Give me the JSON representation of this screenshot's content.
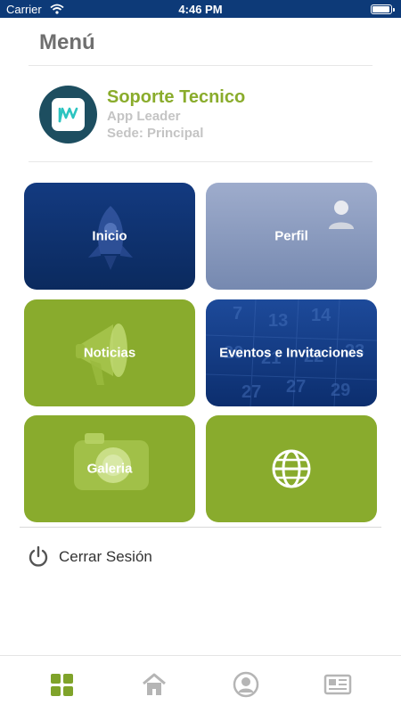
{
  "status_bar": {
    "carrier": "Carrier",
    "time": "4:46 PM"
  },
  "menu": {
    "title": "Menú"
  },
  "profile": {
    "name": "Soporte Tecnico",
    "role": "App Leader",
    "site": "Sede: Principal"
  },
  "tiles": [
    {
      "label": "Inicio",
      "icon": "rocket-icon"
    },
    {
      "label": "Perfil",
      "icon": "user-icon"
    },
    {
      "label": "Noticias",
      "icon": "megaphone-icon"
    },
    {
      "label": "Eventos e Invitaciones",
      "icon": "calendar-icon"
    },
    {
      "label": "Galeria",
      "icon": "camera-icon"
    },
    {
      "label": "",
      "icon": "globe-icon"
    }
  ],
  "logout": {
    "label": "Cerrar Sesión",
    "icon": "power-icon"
  },
  "bottom_nav": [
    {
      "icon": "grid-icon",
      "active": true
    },
    {
      "icon": "home-icon",
      "active": false
    },
    {
      "icon": "user-circle-icon",
      "active": false
    },
    {
      "icon": "newspaper-icon",
      "active": false
    }
  ],
  "colors": {
    "accent_green": "#8aac2c",
    "navy": "#0d3a78",
    "muted_gray": "#c4c4c4",
    "icon_gray": "#b5b5b5"
  }
}
